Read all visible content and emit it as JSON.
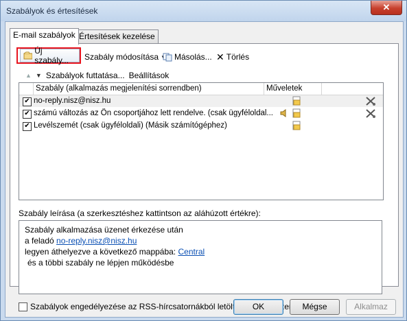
{
  "window": {
    "title": "Szabályok és értesítések",
    "close_label": "✕"
  },
  "tabs": [
    {
      "label": "E-mail szabályok",
      "active": true
    },
    {
      "label": "Értesítések kezelése",
      "active": false
    }
  ],
  "toolbar": {
    "new_rule": "Új szabály...",
    "modify_rule": "Szabály módosítása",
    "copy": "Másolás...",
    "delete": "Törlés"
  },
  "subtoolbar": {
    "run_rules": "Szabályok futtatása...",
    "options": "Beállítások"
  },
  "list": {
    "headers": {
      "rule": "Szabály (alkalmazás megjelenítési sorrendben)",
      "actions": "Műveletek"
    },
    "rows": [
      {
        "checked": true,
        "text": "no-reply.nisz@nisz.hu",
        "selected": true,
        "sound": false
      },
      {
        "checked": true,
        "text": "számú változás az Ön csoportjához lett rendelve.  (csak ügyféloldal...",
        "selected": false,
        "sound": true
      },
      {
        "checked": true,
        "text": "Levélszemét  (csak ügyféloldali)  (Másik számítógéphez)",
        "selected": false,
        "sound": false
      }
    ]
  },
  "description": {
    "label": "Szabály leírása (a szerkesztéshez kattintson az aláhúzott értékre):",
    "line1": "Szabály alkalmazása üzenet érkezése után",
    "line2_prefix": "a feladó",
    "line2_link": "no-reply.nisz@nisz.hu",
    "line3_prefix": "legyen áthelyezve a következő mappába:",
    "line3_link": "Central",
    "line4": "és a többi szabály ne lépjen működésbe"
  },
  "rss_label": "Szabályok engedélyezése az RSS-hírcsatornákból letöltött minden üzenetre",
  "buttons": {
    "ok": "OK",
    "cancel": "Mégse",
    "apply": "Alkalmaz"
  }
}
